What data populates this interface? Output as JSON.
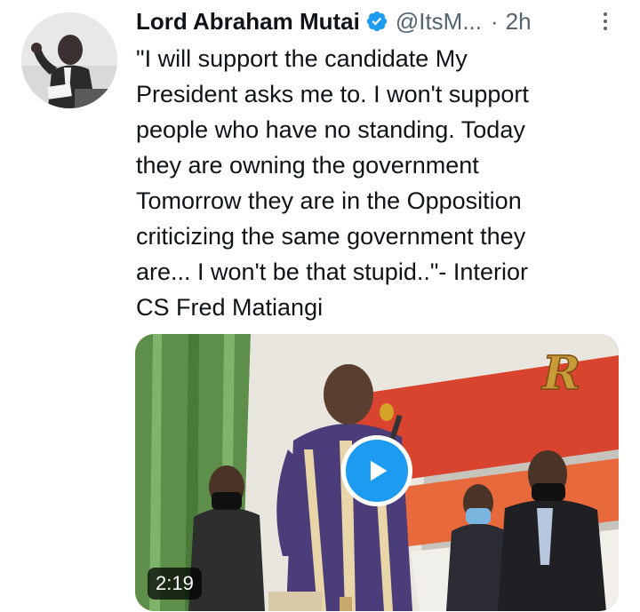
{
  "tweet": {
    "author_name": "Lord Abraham Mutai",
    "handle": "@ItsM...",
    "separator": "·",
    "time": "2h",
    "text": "\"I will support the candidate My\nPresident asks me to. I won't support\npeople who have no standing. Today\nthey are owning the government\nTomorrow they are in the Opposition\ncriticizing the same government they\nare... I won't be that stupid..\"- Interior\nCS Fred Matiangi",
    "media": {
      "type": "video",
      "duration": "2:19",
      "watermark": "R"
    }
  },
  "icons": {
    "verified": "verified-badge-icon",
    "more": "more-options-icon",
    "play": "play-icon"
  },
  "colors": {
    "accent": "#1d9bf0",
    "text_primary": "#0f1419",
    "text_secondary": "#536471"
  }
}
